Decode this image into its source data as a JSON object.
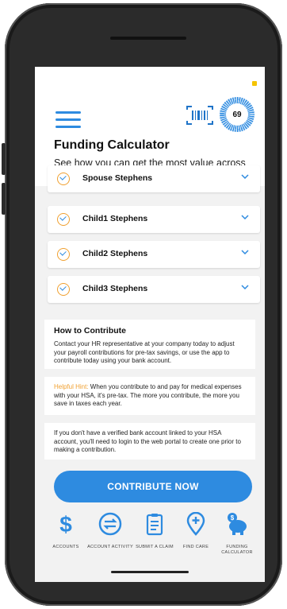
{
  "header": {
    "title": "Funding Calculator",
    "subtitle": "See how you can get the most value across your healthcare journey.",
    "score": "69"
  },
  "dependents": [
    {
      "name": "Spouse Stephens"
    },
    {
      "name": "Child1 Stephens"
    },
    {
      "name": "Child2 Stephens"
    },
    {
      "name": "Child3 Stephens"
    }
  ],
  "contribute_info": {
    "title": "How to Contribute",
    "text": "Contact your HR representative at your company today to adjust your payroll contributions for pre-tax savings, or use the app to contribute today using your bank account."
  },
  "hint": {
    "label": "Helpful Hint:",
    "text": " When you contribute to and pay for medical expenses with your HSA, it's pre-tax. The more you contribute, the more you save in taxes each year."
  },
  "bank_note": {
    "text": "If you don't have a verified bank account linked to your HSA account, you'll need to login to the web portal to create one prior to making a contribution."
  },
  "cta": {
    "label": "CONTRIBUTE NOW"
  },
  "nav": [
    {
      "label": "ACCOUNTS",
      "icon": "dollar-icon"
    },
    {
      "label": "ACCOUNT ACTIVITY",
      "icon": "swap-icon"
    },
    {
      "label": "SUBMIT A CLAIM",
      "icon": "clipboard-icon"
    },
    {
      "label": "FIND CARE",
      "icon": "map-pin-icon"
    },
    {
      "label": "FUNDING CALCULATOR",
      "icon": "piggy-bank-icon"
    }
  ],
  "colors": {
    "accent": "#2e8be0",
    "check_ring": "#f0a030",
    "status": "#f5c400"
  }
}
